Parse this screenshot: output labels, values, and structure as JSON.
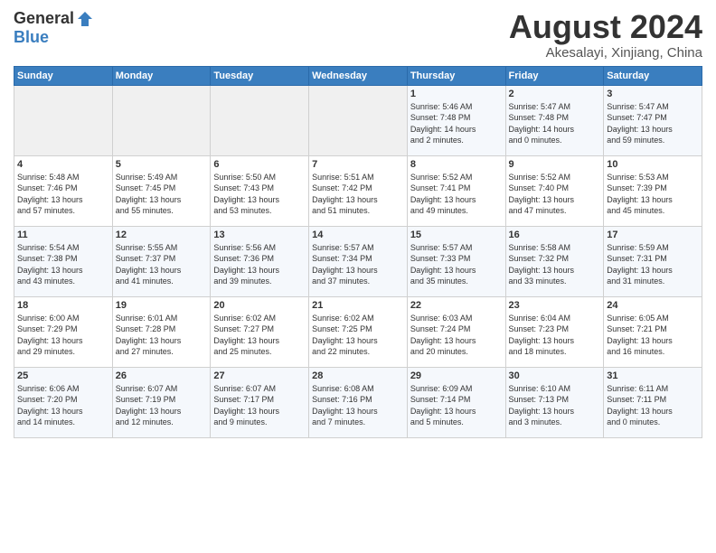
{
  "header": {
    "logo_general": "General",
    "logo_blue": "Blue",
    "month_year": "August 2024",
    "location": "Akesalayi, Xinjiang, China"
  },
  "weekdays": [
    "Sunday",
    "Monday",
    "Tuesday",
    "Wednesday",
    "Thursday",
    "Friday",
    "Saturday"
  ],
  "weeks": [
    [
      {
        "day": "",
        "info": ""
      },
      {
        "day": "",
        "info": ""
      },
      {
        "day": "",
        "info": ""
      },
      {
        "day": "",
        "info": ""
      },
      {
        "day": "1",
        "info": "Sunrise: 5:46 AM\nSunset: 7:48 PM\nDaylight: 14 hours\nand 2 minutes."
      },
      {
        "day": "2",
        "info": "Sunrise: 5:47 AM\nSunset: 7:48 PM\nDaylight: 14 hours\nand 0 minutes."
      },
      {
        "day": "3",
        "info": "Sunrise: 5:47 AM\nSunset: 7:47 PM\nDaylight: 13 hours\nand 59 minutes."
      }
    ],
    [
      {
        "day": "4",
        "info": "Sunrise: 5:48 AM\nSunset: 7:46 PM\nDaylight: 13 hours\nand 57 minutes."
      },
      {
        "day": "5",
        "info": "Sunrise: 5:49 AM\nSunset: 7:45 PM\nDaylight: 13 hours\nand 55 minutes."
      },
      {
        "day": "6",
        "info": "Sunrise: 5:50 AM\nSunset: 7:43 PM\nDaylight: 13 hours\nand 53 minutes."
      },
      {
        "day": "7",
        "info": "Sunrise: 5:51 AM\nSunset: 7:42 PM\nDaylight: 13 hours\nand 51 minutes."
      },
      {
        "day": "8",
        "info": "Sunrise: 5:52 AM\nSunset: 7:41 PM\nDaylight: 13 hours\nand 49 minutes."
      },
      {
        "day": "9",
        "info": "Sunrise: 5:52 AM\nSunset: 7:40 PM\nDaylight: 13 hours\nand 47 minutes."
      },
      {
        "day": "10",
        "info": "Sunrise: 5:53 AM\nSunset: 7:39 PM\nDaylight: 13 hours\nand 45 minutes."
      }
    ],
    [
      {
        "day": "11",
        "info": "Sunrise: 5:54 AM\nSunset: 7:38 PM\nDaylight: 13 hours\nand 43 minutes."
      },
      {
        "day": "12",
        "info": "Sunrise: 5:55 AM\nSunset: 7:37 PM\nDaylight: 13 hours\nand 41 minutes."
      },
      {
        "day": "13",
        "info": "Sunrise: 5:56 AM\nSunset: 7:36 PM\nDaylight: 13 hours\nand 39 minutes."
      },
      {
        "day": "14",
        "info": "Sunrise: 5:57 AM\nSunset: 7:34 PM\nDaylight: 13 hours\nand 37 minutes."
      },
      {
        "day": "15",
        "info": "Sunrise: 5:57 AM\nSunset: 7:33 PM\nDaylight: 13 hours\nand 35 minutes."
      },
      {
        "day": "16",
        "info": "Sunrise: 5:58 AM\nSunset: 7:32 PM\nDaylight: 13 hours\nand 33 minutes."
      },
      {
        "day": "17",
        "info": "Sunrise: 5:59 AM\nSunset: 7:31 PM\nDaylight: 13 hours\nand 31 minutes."
      }
    ],
    [
      {
        "day": "18",
        "info": "Sunrise: 6:00 AM\nSunset: 7:29 PM\nDaylight: 13 hours\nand 29 minutes."
      },
      {
        "day": "19",
        "info": "Sunrise: 6:01 AM\nSunset: 7:28 PM\nDaylight: 13 hours\nand 27 minutes."
      },
      {
        "day": "20",
        "info": "Sunrise: 6:02 AM\nSunset: 7:27 PM\nDaylight: 13 hours\nand 25 minutes."
      },
      {
        "day": "21",
        "info": "Sunrise: 6:02 AM\nSunset: 7:25 PM\nDaylight: 13 hours\nand 22 minutes."
      },
      {
        "day": "22",
        "info": "Sunrise: 6:03 AM\nSunset: 7:24 PM\nDaylight: 13 hours\nand 20 minutes."
      },
      {
        "day": "23",
        "info": "Sunrise: 6:04 AM\nSunset: 7:23 PM\nDaylight: 13 hours\nand 18 minutes."
      },
      {
        "day": "24",
        "info": "Sunrise: 6:05 AM\nSunset: 7:21 PM\nDaylight: 13 hours\nand 16 minutes."
      }
    ],
    [
      {
        "day": "25",
        "info": "Sunrise: 6:06 AM\nSunset: 7:20 PM\nDaylight: 13 hours\nand 14 minutes."
      },
      {
        "day": "26",
        "info": "Sunrise: 6:07 AM\nSunset: 7:19 PM\nDaylight: 13 hours\nand 12 minutes."
      },
      {
        "day": "27",
        "info": "Sunrise: 6:07 AM\nSunset: 7:17 PM\nDaylight: 13 hours\nand 9 minutes."
      },
      {
        "day": "28",
        "info": "Sunrise: 6:08 AM\nSunset: 7:16 PM\nDaylight: 13 hours\nand 7 minutes."
      },
      {
        "day": "29",
        "info": "Sunrise: 6:09 AM\nSunset: 7:14 PM\nDaylight: 13 hours\nand 5 minutes."
      },
      {
        "day": "30",
        "info": "Sunrise: 6:10 AM\nSunset: 7:13 PM\nDaylight: 13 hours\nand 3 minutes."
      },
      {
        "day": "31",
        "info": "Sunrise: 6:11 AM\nSunset: 7:11 PM\nDaylight: 13 hours\nand 0 minutes."
      }
    ]
  ]
}
